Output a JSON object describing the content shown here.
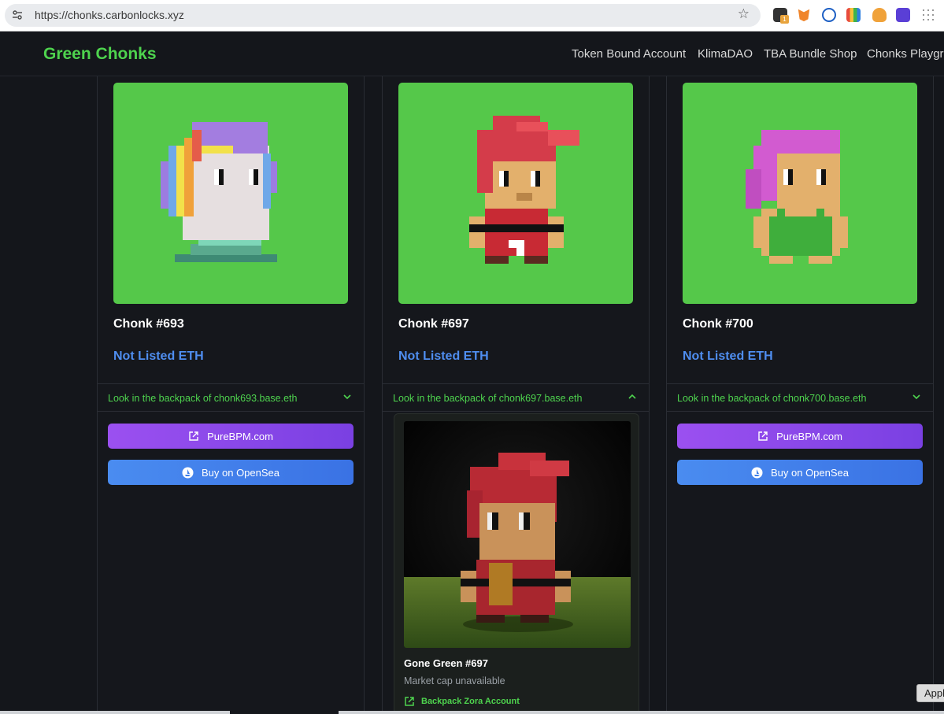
{
  "browser": {
    "url": "https://chonks.carbonlocks.xyz",
    "extension_badge": "1"
  },
  "nav": {
    "brand": "Green Chonks",
    "links": [
      "Token Bound Account",
      "KlimaDAO",
      "TBA Bundle Shop",
      "Chonks Playgro"
    ]
  },
  "cards": [
    {
      "title": "Chonk #693",
      "price": "Not Listed ETH",
      "accordion_label": "Look in the backpack of chonk693.base.eth",
      "accordion_state": "collapsed",
      "buttons": [
        "PureBPM.com",
        "Buy on OpenSea"
      ]
    },
    {
      "title": "Chonk #697",
      "price": "Not Listed ETH",
      "accordion_label": "Look in the backpack of chonk697.base.eth",
      "accordion_state": "expanded",
      "backpack_item": {
        "title": "Gone Green #697",
        "subtitle": "Market cap unavailable",
        "link": "Backpack Zora Account"
      }
    },
    {
      "title": "Chonk #700",
      "price": "Not Listed ETH",
      "accordion_label": "Look in the backpack of chonk700.base.eth",
      "accordion_state": "collapsed",
      "buttons": [
        "PureBPM.com",
        "Buy on OpenSea"
      ]
    }
  ],
  "overlay": {
    "apply_button": "Appl"
  },
  "colors": {
    "brand_green": "#4ed34e",
    "price_blue": "#4f8ef0",
    "card_bg_green": "#55c84a",
    "purple_button": "#8a48ea",
    "blue_button": "#3f7ee8"
  }
}
